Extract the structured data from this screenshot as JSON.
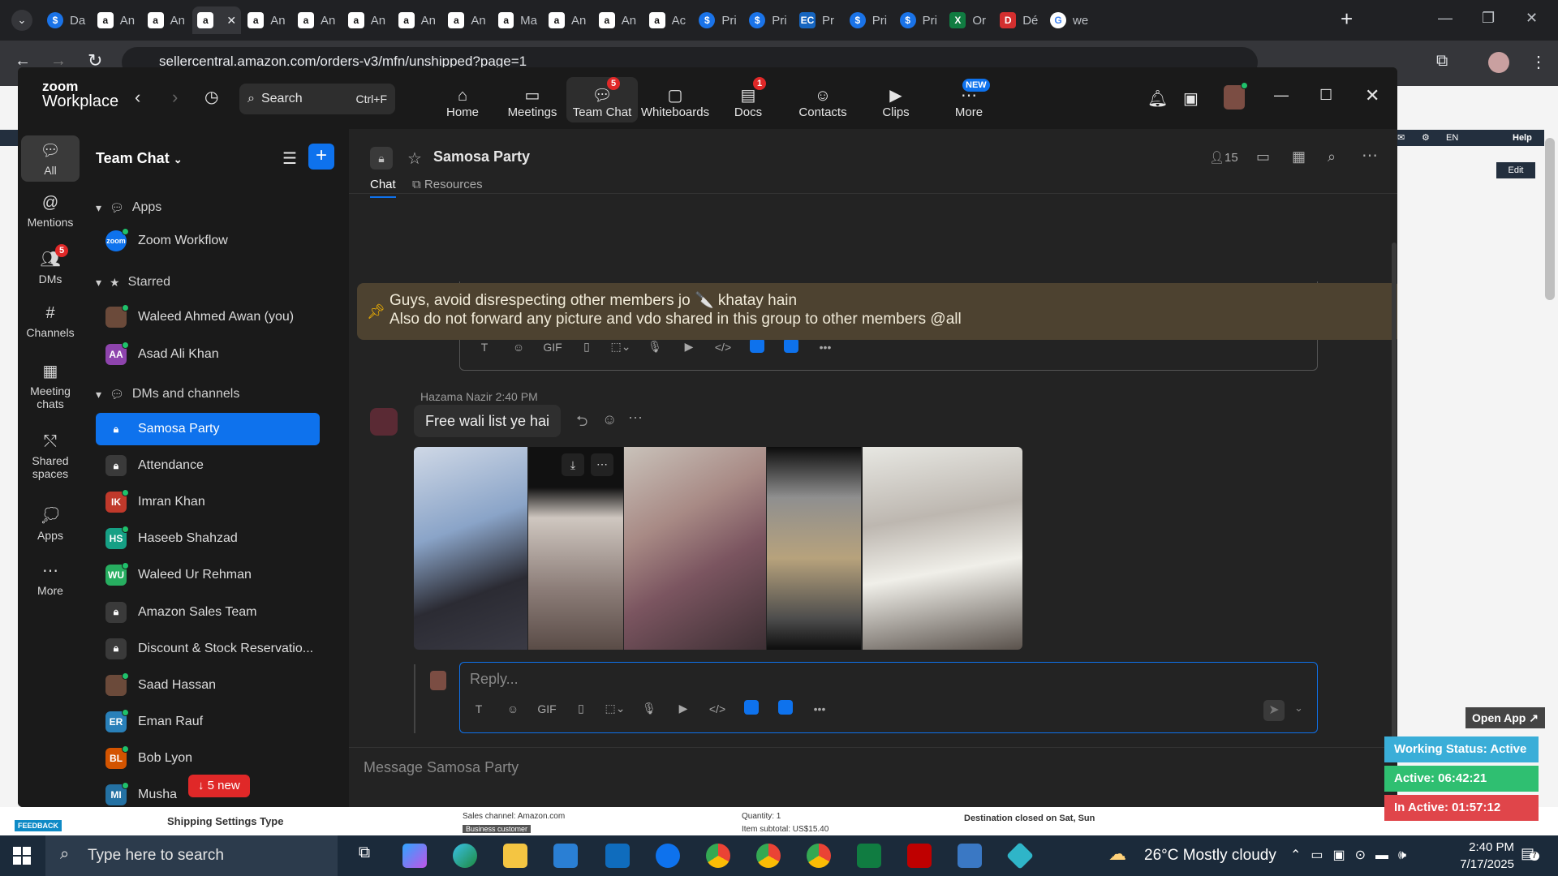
{
  "browser": {
    "tabs": [
      {
        "icon": "chrome-webstore-icon",
        "label": "Da",
        "type": "s"
      },
      {
        "icon": "amazon-icon",
        "label": "An",
        "type": "amz"
      },
      {
        "icon": "amazon-icon",
        "label": "An",
        "type": "amz"
      },
      {
        "icon": "amazon-icon",
        "label": "",
        "type": "amz",
        "active": true
      },
      {
        "icon": "amazon-icon",
        "label": "An",
        "type": "amz"
      },
      {
        "icon": "amazon-icon",
        "label": "An",
        "type": "amz"
      },
      {
        "icon": "amazon-icon",
        "label": "An",
        "type": "amz"
      },
      {
        "icon": "amazon-icon",
        "label": "An",
        "type": "amz"
      },
      {
        "icon": "amazon-icon",
        "label": "An",
        "type": "amz"
      },
      {
        "icon": "amazon-icon",
        "label": "Ma",
        "type": "amz"
      },
      {
        "icon": "amazon-icon",
        "label": "An",
        "type": "amz"
      },
      {
        "icon": "amazon-icon",
        "label": "An",
        "type": "amz"
      },
      {
        "icon": "amazon-icon",
        "label": "Ac",
        "type": "amz"
      },
      {
        "icon": "s-icon",
        "label": "Pri",
        "type": "s"
      },
      {
        "icon": "s-icon",
        "label": "Pri",
        "type": "s"
      },
      {
        "icon": "ec-icon",
        "label": "Pr",
        "type": "ec"
      },
      {
        "icon": "s-icon",
        "label": "Pri",
        "type": "s"
      },
      {
        "icon": "s-icon",
        "label": "Pri",
        "type": "s"
      },
      {
        "icon": "excel-icon",
        "label": "Or",
        "type": "x"
      },
      {
        "icon": "d-icon",
        "label": "Dé",
        "type": "d"
      },
      {
        "icon": "google-icon",
        "label": "we",
        "type": "g"
      }
    ],
    "url": "sellercentral.amazon.com/orders-v3/mfn/unshipped?page=1"
  },
  "amazon_bg": {
    "lang": "EN",
    "help": "Help",
    "edit": "Edit",
    "feedback": "FEEDBACK",
    "shipping_settings": "Shipping Settings Type",
    "sales_channel": "Sales channel: Amazon.com",
    "business_customer": "Business customer",
    "quantity": "Quantity: 1",
    "item_subtotal": "Item subtotal: US$15.40",
    "destination": "Destination closed on Sat, Sun"
  },
  "zoom": {
    "logo_line1": "zoom",
    "logo_line2": "Workplace",
    "search_label": "Search",
    "search_shortcut": "Ctrl+F",
    "nav": [
      {
        "label": "Home",
        "icon": "home-icon"
      },
      {
        "label": "Meetings",
        "icon": "video-icon"
      },
      {
        "label": "Team Chat",
        "icon": "chat-icon",
        "badge": "5"
      },
      {
        "label": "Whiteboards",
        "icon": "whiteboard-icon"
      },
      {
        "label": "Docs",
        "icon": "docs-icon",
        "badge": "1"
      },
      {
        "label": "Contacts",
        "icon": "contacts-icon"
      },
      {
        "label": "Clips",
        "icon": "clips-icon"
      },
      {
        "label": "More",
        "icon": "more-icon",
        "badge_text": "NEW"
      }
    ],
    "rail": [
      {
        "label": "All",
        "icon": "chat-bubble-icon"
      },
      {
        "label": "Mentions",
        "icon": "at-icon"
      },
      {
        "label": "DMs",
        "icon": "people-icon",
        "badge": "5"
      },
      {
        "label": "Channels",
        "icon": "hash-icon"
      },
      {
        "label": "Meeting chats",
        "icon": "calendar-icon"
      },
      {
        "label": "Shared spaces",
        "icon": "share-icon"
      },
      {
        "label": "Apps",
        "icon": "apps-icon"
      },
      {
        "label": "More",
        "icon": "ellipsis-icon"
      }
    ],
    "sidebar": {
      "title": "Team Chat",
      "sections": {
        "apps": "Apps",
        "starred": "Starred",
        "dms_channels": "DMs and channels"
      },
      "apps": [
        {
          "label": "Zoom Workflow",
          "initials": "zoom",
          "color": "#0e72ed"
        }
      ],
      "starred": [
        {
          "label": "Waleed Ahmed Awan (you)",
          "initials": "",
          "color": "#6b4a3a",
          "photo": true
        },
        {
          "label": "Asad Ali Khan",
          "initials": "AA",
          "color": "#8e44ad"
        }
      ],
      "channels": [
        {
          "label": "Samosa Party",
          "lock": true,
          "selected": true
        },
        {
          "label": "Attendance",
          "lock": true
        },
        {
          "label": "Imran Khan",
          "initials": "IK",
          "color": "#c0392b"
        },
        {
          "label": "Haseeb Shahzad",
          "initials": "HS",
          "color": "#16a085"
        },
        {
          "label": "Waleed Ur Rehman",
          "initials": "WU",
          "color": "#27ae60"
        },
        {
          "label": "Amazon Sales Team",
          "lock": true
        },
        {
          "label": "Discount & Stock Reservatio...",
          "lock": true
        },
        {
          "label": "Saad Hassan",
          "initials": "",
          "color": "#6b4a3a",
          "photo": true
        },
        {
          "label": "Eman Rauf",
          "initials": "ER",
          "color": "#2980b9"
        },
        {
          "label": "Bob Lyon",
          "initials": "BL",
          "color": "#d35400"
        },
        {
          "label": "Musha",
          "initials": "MI",
          "color": "#2471a3"
        }
      ],
      "new_pill": "5 new"
    },
    "chat": {
      "channel_name": "Samosa Party",
      "member_count": "15",
      "tabs": [
        "Chat",
        "Resources"
      ],
      "pinned_line1": "Guys, avoid disrespecting other members jo 🔪 khatay hain",
      "pinned_line2": "Also do not forward any picture and vdo shared in this group to other members @all",
      "message": {
        "author": "Hazama Nazir",
        "time": "2:40 PM",
        "text": "Free wali list ye hai"
      },
      "reply_placeholder": "Reply...",
      "compose_placeholder": "Message Samosa Party",
      "tool_gif": "GIF"
    }
  },
  "widgets": {
    "open_app": "Open App ↗",
    "working_status": "Working Status: Active",
    "active": "Active: 06:42:21",
    "inactive": "In Active: 01:57:12"
  },
  "taskbar": {
    "search_placeholder": "Type here to search",
    "weather": "26°C  Mostly cloudy",
    "time": "2:40 PM",
    "date": "7/17/2025",
    "notif_count": "7"
  }
}
